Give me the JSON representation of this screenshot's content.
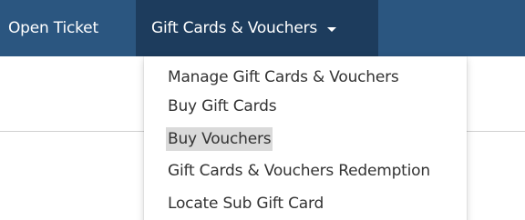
{
  "navbar": {
    "items": [
      {
        "label": "Open Ticket"
      },
      {
        "label": "Gift Cards & Vouchers"
      }
    ],
    "background": "#2b5680",
    "active_background": "#1d3c5d"
  },
  "dropdown": {
    "items": [
      {
        "label": "Manage Gift Cards & Vouchers"
      },
      {
        "label": "Buy Gift Cards"
      },
      {
        "label": "Buy Vouchers",
        "highlighted": true
      },
      {
        "label": "Gift Cards & Vouchers Redemption"
      },
      {
        "label": "Locate Sub Gift Card"
      }
    ],
    "highlight_color": "#dadada"
  }
}
